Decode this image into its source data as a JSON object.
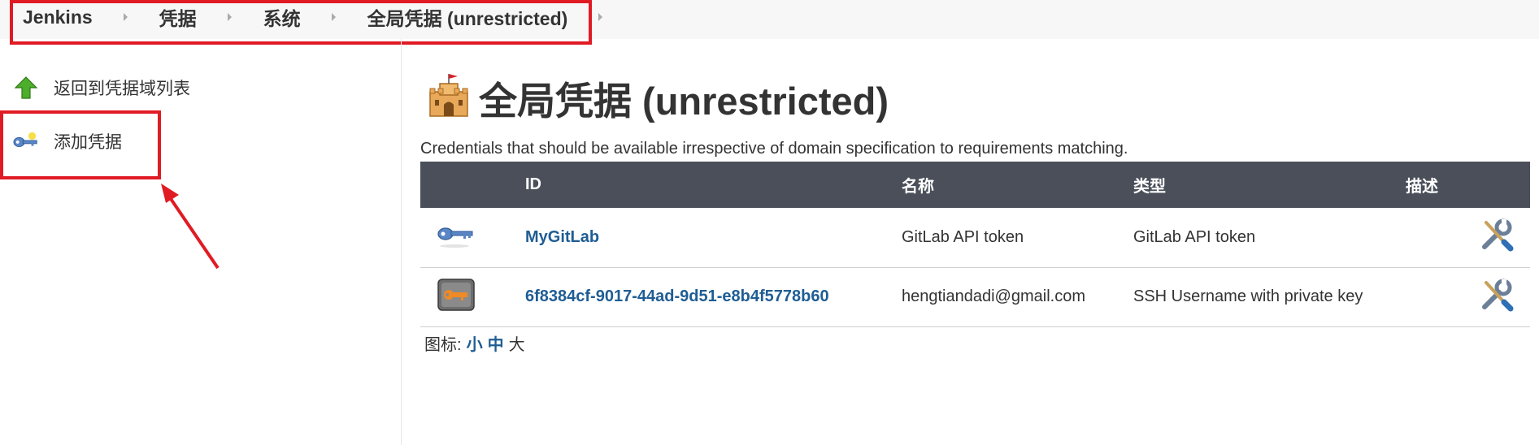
{
  "breadcrumb": {
    "items": [
      "Jenkins",
      "凭据",
      "系统",
      "全局凭据 (unrestricted)"
    ]
  },
  "sidebar": {
    "tasks": [
      {
        "label": "返回到凭据域列表",
        "icon": "up-arrow-icon"
      },
      {
        "label": "添加凭据",
        "icon": "key-icon"
      }
    ]
  },
  "main": {
    "title": "全局凭据 (unrestricted)",
    "title_icon": "castle-icon",
    "description": "Credentials that should be available irrespective of domain specification to requirements matching.",
    "table": {
      "headers": [
        "",
        "ID",
        "名称",
        "类型",
        "描述"
      ],
      "rows": [
        {
          "icon": "key-icon",
          "id": "MyGitLab",
          "name": "GitLab API token",
          "type": "GitLab API token",
          "action_icon": "wrench-screwdriver-icon"
        },
        {
          "icon": "ssh-key-icon",
          "id": "6f8384cf-9017-44ad-9d51-e8b4f5778b60",
          "name": "hengtiandadi@gmail.com",
          "type": "SSH Username with private key",
          "action_icon": "wrench-screwdriver-icon"
        }
      ]
    },
    "icon_size": {
      "label": "图标:",
      "options": [
        "小",
        "中",
        "大"
      ]
    }
  },
  "colors": {
    "header_bg": "#4a4f5a",
    "link": "#1f5d94",
    "highlight": "#e01b24"
  }
}
